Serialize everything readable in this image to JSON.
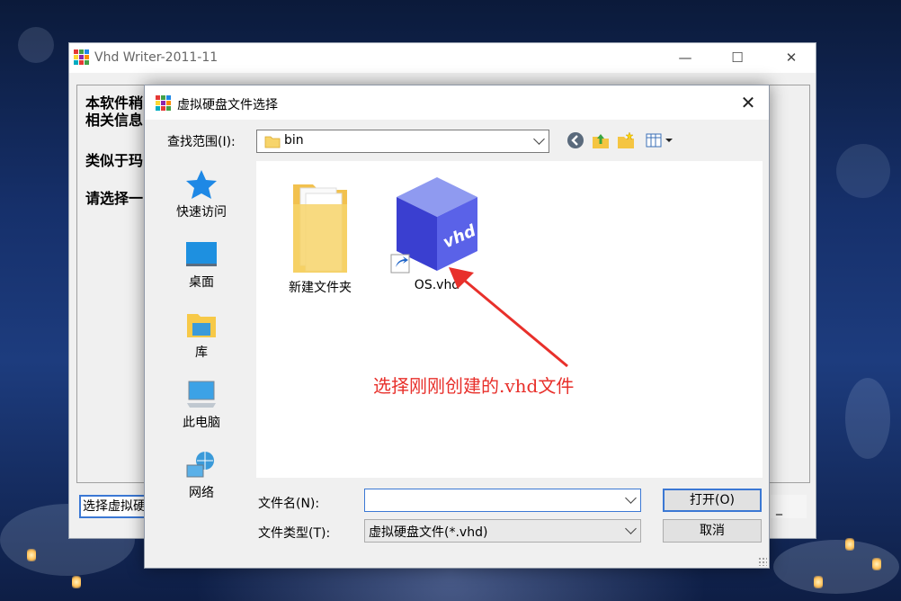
{
  "main_window": {
    "title": "Vhd Writer-2011-11",
    "controls": {
      "minimize": "—",
      "maximize": "☐",
      "close": "✕"
    },
    "lines": [
      "本软件稍",
      "相关信息",
      "类似于玛",
      "请选择一"
    ],
    "select_button": "选择虚拟硬",
    "right_button": "_"
  },
  "dialog": {
    "title": "虚拟硬盘文件选择",
    "close": "✕",
    "lookin_label": "查找范围(I):",
    "lookin_value": "bin",
    "places": [
      {
        "label": "快速访问",
        "icon": "quick-access-star-icon"
      },
      {
        "label": "桌面",
        "icon": "desktop-icon"
      },
      {
        "label": "库",
        "icon": "library-icon"
      },
      {
        "label": "此电脑",
        "icon": "this-pc-icon"
      },
      {
        "label": "网络",
        "icon": "network-icon"
      }
    ],
    "files": [
      {
        "name": "新建文件夹",
        "icon": "folder-icon"
      },
      {
        "name": "OS.vhd",
        "icon": "vhd-file-icon",
        "cube_text": "vhd"
      }
    ],
    "filename_label": "文件名(N):",
    "filename_value": "",
    "filetype_label": "文件类型(T):",
    "filetype_value": "虚拟硬盘文件(*.vhd)",
    "open_button": "打开(O)",
    "cancel_button": "取消"
  },
  "annotation": {
    "text": "选择刚刚创建的.vhd文件",
    "color": "#e8302b"
  },
  "colors": {
    "accent_blue": "#3b78d4",
    "folder_yellow": "#f7d46a"
  }
}
